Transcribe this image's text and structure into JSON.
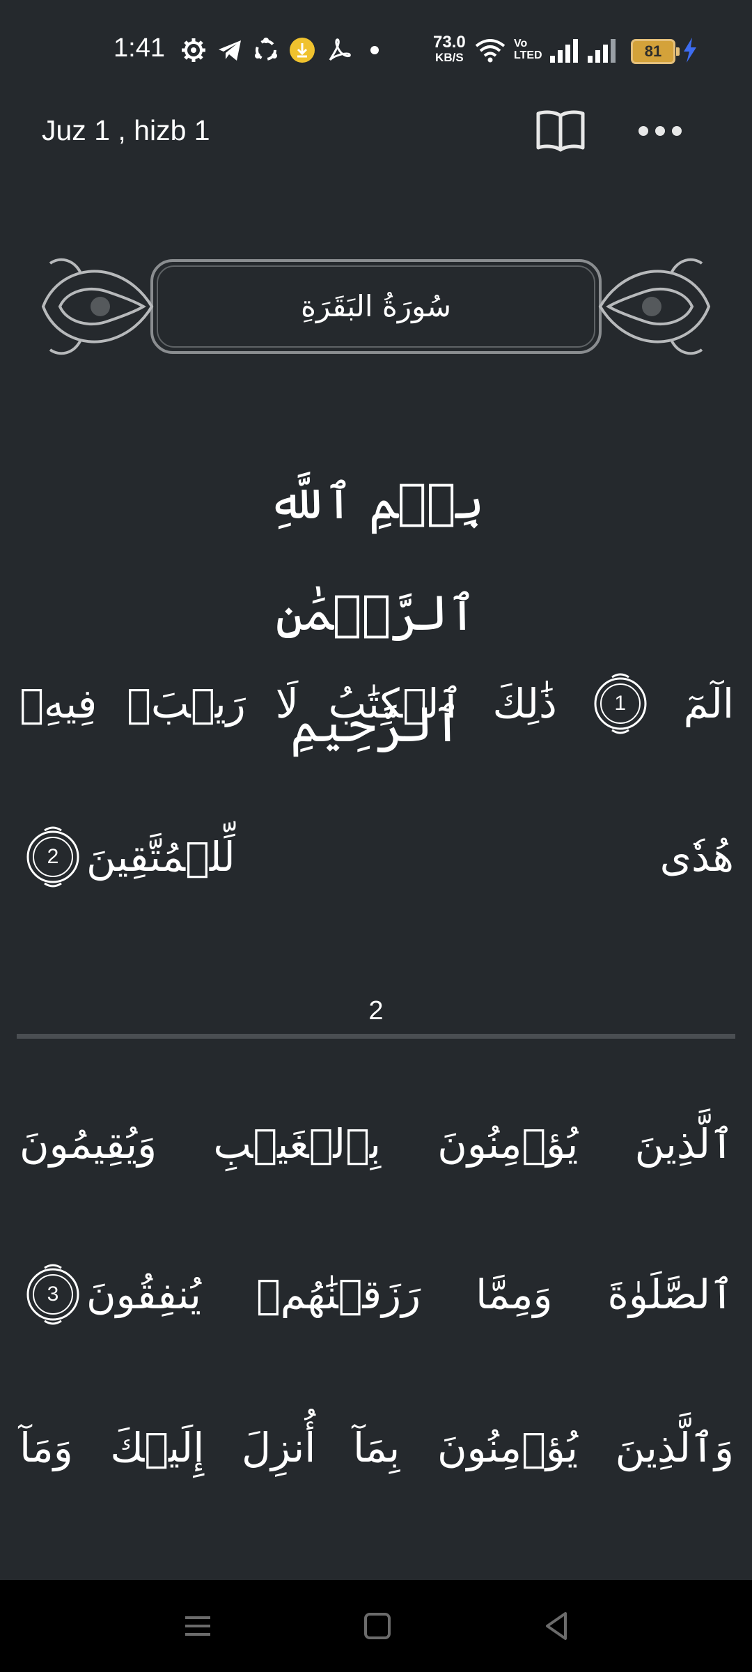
{
  "status_bar": {
    "time": "1:41",
    "net_speed_value": "73.0",
    "net_speed_unit": "KB/S",
    "volte": "Vo LTED",
    "battery_level": "81",
    "icons": [
      "settings-icon",
      "telegram-icon",
      "sync-icon",
      "download-badge-icon",
      "pdf-icon",
      "dot-icon",
      "wifi-icon",
      "signal-icon",
      "signal-icon-2",
      "charging-icon"
    ]
  },
  "top_bar": {
    "title": "Juz 1 , hizb 1",
    "actions": [
      "book-icon",
      "more-options-icon"
    ]
  },
  "surah_header": {
    "name": "سُورَةُ البَقَرَةِ"
  },
  "bismillah": "بِسۡمِ ٱللَّهِ ٱلرَّحۡمَٰنِ ٱلرَّحِيمِ",
  "page_one": {
    "line1": {
      "word_a": "الٓمٓ",
      "marker": "1",
      "word_b": "ذَٰلِكَ",
      "word_c": "ٱلۡكِتَٰبُ",
      "word_d": "لَا",
      "word_e": "رَيۡبَۛ",
      "word_f": "فِيهِۛ"
    },
    "line2": {
      "word_a": "هُدٗى",
      "word_b": "لِّلۡمُتَّقِينَ",
      "marker": "2"
    }
  },
  "page_number": "2",
  "page_two": {
    "line1": {
      "word_a": "ٱلَّذِينَ",
      "word_b": "يُؤۡمِنُونَ",
      "word_c": "بِٱلۡغَيۡبِ",
      "word_d": "وَيُقِيمُونَ"
    },
    "line2": {
      "word_a": "ٱلصَّلَوٰةَ",
      "word_b": "وَمِمَّا",
      "word_c": "رَزَقۡنَٰهُمۡ",
      "word_d": "يُنفِقُونَ",
      "marker": "3"
    },
    "line3": {
      "word_a": "وَٱلَّذِينَ",
      "word_b": "يُؤۡمِنُونَ",
      "word_c": "بِمَآ",
      "word_d": "أُنزِلَ",
      "word_e": "إِلَيۡكَ",
      "word_f": "وَمَآ"
    }
  },
  "nav_bar": [
    "menu-icon",
    "home-icon",
    "back-icon"
  ],
  "colors": {
    "background": "#25292d",
    "text": "#ffffff",
    "divider": "#4a4e52",
    "battery": "#d4a23a",
    "nav_bar": "#000000"
  }
}
